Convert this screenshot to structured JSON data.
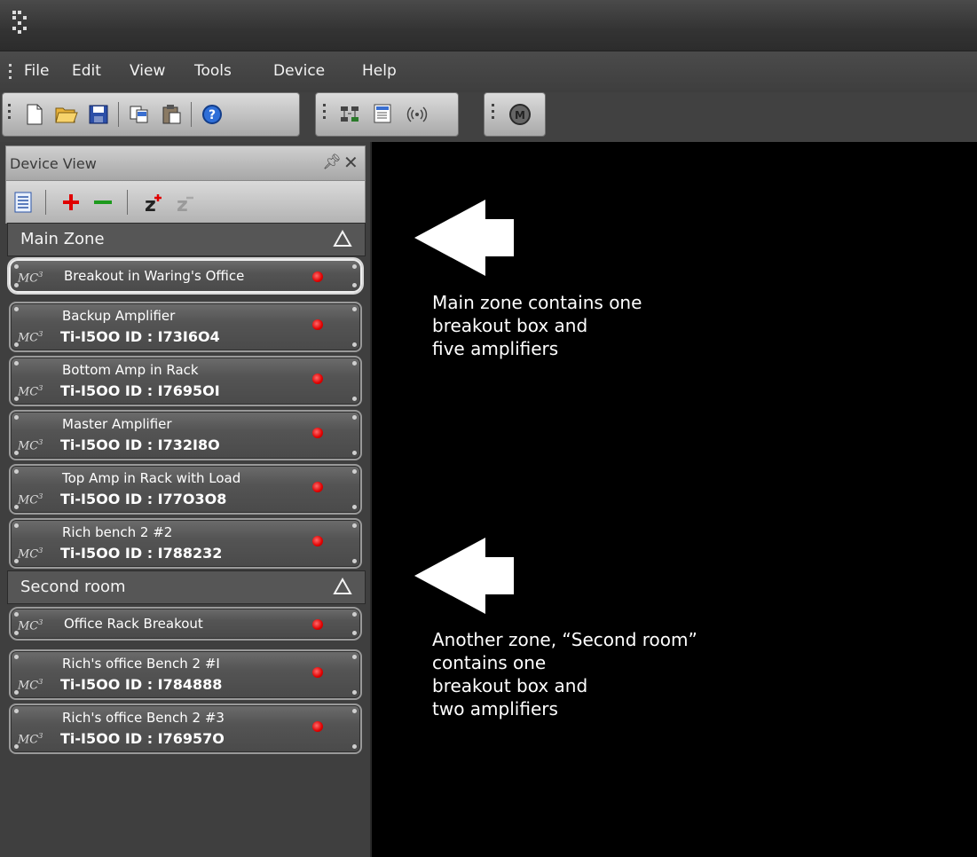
{
  "titlebar": {
    "app_icon": "app-logo-icon"
  },
  "menubar": {
    "items": [
      "File",
      "Edit",
      "View",
      "Tools",
      "Device",
      "Help"
    ]
  },
  "toolbar": {
    "groups": [
      [
        "new-document-icon",
        "open-folder-icon",
        "save-icon",
        "copy-icon",
        "paste-icon",
        "help-icon"
      ],
      [
        "network-view-icon",
        "list-view-icon",
        "wireless-icon"
      ],
      [
        "mute-m-icon"
      ]
    ]
  },
  "device_view": {
    "title": "Device View",
    "toolbar_icons": [
      "properties-icon",
      "add-icon",
      "remove-icon",
      "zone-add-icon",
      "zone-remove-icon"
    ],
    "zones": [
      {
        "name": "Main Zone",
        "devices": [
          {
            "name": "Breakout in Waring's Office",
            "model": "",
            "type": "breakout",
            "selected": true
          },
          {
            "name": "Backup Amplifier",
            "model": "Ti-I5OO  ID : I73I6O4",
            "type": "amplifier"
          },
          {
            "name": "Bottom Amp in Rack",
            "model": "Ti-I5OO  ID : I7695OI",
            "type": "amplifier"
          },
          {
            "name": "Master Amplifier",
            "model": "Ti-I5OO  ID : I732I8O",
            "type": "amplifier"
          },
          {
            "name": "Top Amp in Rack with Load",
            "model": "Ti-I5OO  ID : I77O3O8",
            "type": "amplifier"
          },
          {
            "name": "Rich bench 2 #2",
            "model": "Ti-I5OO  ID : I788232",
            "type": "amplifier"
          }
        ]
      },
      {
        "name": "Second room",
        "devices": [
          {
            "name": "Office Rack Breakout",
            "model": "",
            "type": "breakout"
          },
          {
            "name": "Rich's office Bench 2 #I",
            "model": "Ti-I5OO  ID : I784888",
            "type": "amplifier"
          },
          {
            "name": "Rich's office Bench 2 #3",
            "model": "Ti-I5OO  ID : I76957O",
            "type": "amplifier"
          }
        ]
      }
    ]
  },
  "mc_logo": "MC",
  "annotations": [
    {
      "text": "Main zone contains one\nbreakout box and\nfive amplifiers"
    },
    {
      "text": "Another zone, “Second room”\ncontains one\nbreakout box and\ntwo amplifiers"
    }
  ],
  "colors": {
    "status_led": "#e00000",
    "panel_bg": "#3f3f3f",
    "canvas_bg": "#000000"
  }
}
